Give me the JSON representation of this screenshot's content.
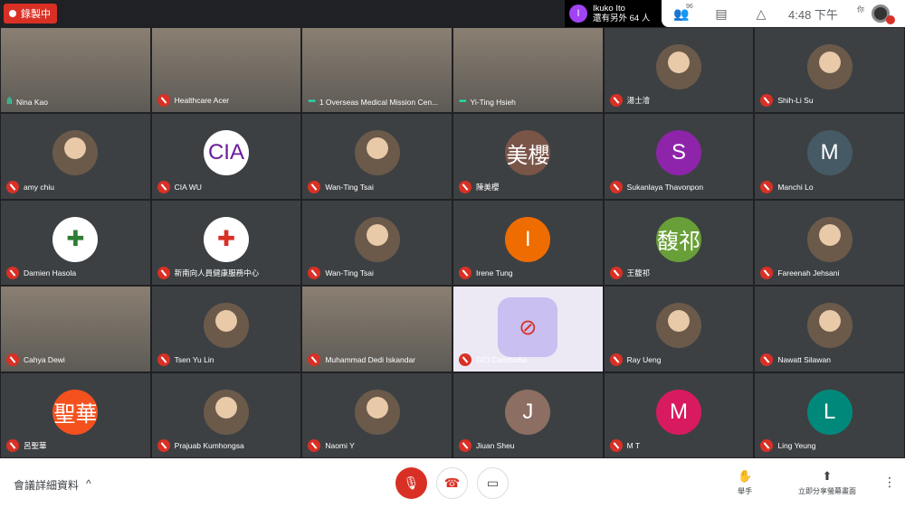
{
  "recording": {
    "label": "錄製中",
    "color": "#d93025"
  },
  "presenter": {
    "initial": "I",
    "name": "Ikuko Ito",
    "others": "還有另外 64 人"
  },
  "header": {
    "participant_count": "96",
    "time": "4:48 下午",
    "you_label": "你"
  },
  "tiles": [
    {
      "name": "Nina Kao",
      "type": "video",
      "status": "speaking"
    },
    {
      "name": "Healthcare Acer",
      "type": "video",
      "status": "muted"
    },
    {
      "name": "1 Overseas Medical Mission Cen...",
      "type": "video",
      "status": "speaking"
    },
    {
      "name": "Yi-Ting Hsieh",
      "type": "video",
      "status": "speaking"
    },
    {
      "name": "湯士澮",
      "type": "photo",
      "status": "muted"
    },
    {
      "name": "Shih-Li Su",
      "type": "photo",
      "status": "muted"
    },
    {
      "name": "amy chiu",
      "type": "photo",
      "status": "muted"
    },
    {
      "name": "CIA WU",
      "type": "letter",
      "avatar": "CIA",
      "color": "#ffffff",
      "text_color": "#6a1b9a",
      "status": "muted"
    },
    {
      "name": "Wan-Ting Tsai",
      "type": "photo",
      "status": "muted"
    },
    {
      "name": "陳美櫻",
      "type": "letter",
      "avatar": "美櫻",
      "color": "#795548",
      "status": "muted"
    },
    {
      "name": "Sukanlaya Thavonpon",
      "type": "letter",
      "avatar": "S",
      "color": "#8e24aa",
      "status": "muted"
    },
    {
      "name": "Manchi Lo",
      "type": "letter",
      "avatar": "M",
      "color": "#455a64",
      "status": "muted"
    },
    {
      "name": "Damien Hasola",
      "type": "letter",
      "avatar": "✚",
      "color": "#ffffff",
      "text_color": "#2e7d32",
      "status": "muted"
    },
    {
      "name": "新南向人員健康服務中心",
      "type": "letter",
      "avatar": "✚",
      "color": "#ffffff",
      "text_color": "#d93025",
      "status": "muted"
    },
    {
      "name": "Wan-Ting Tsai",
      "type": "photo",
      "status": "muted"
    },
    {
      "name": "Irene Tung",
      "type": "letter",
      "avatar": "I",
      "color": "#ef6c00",
      "status": "muted"
    },
    {
      "name": "王馥祁",
      "type": "letter",
      "avatar": "馥祁",
      "color": "#689f38",
      "status": "muted"
    },
    {
      "name": "Fareenah Jehsani",
      "type": "photo",
      "status": "muted"
    },
    {
      "name": "Cahya Dewi",
      "type": "video",
      "status": "muted"
    },
    {
      "name": "Tsen Yu Lin",
      "type": "photo",
      "status": "muted"
    },
    {
      "name": "Muhammad Dedi Iskandar",
      "type": "video",
      "status": "muted"
    },
    {
      "name": "GCI Cambodia",
      "type": "camera-off",
      "status": "muted"
    },
    {
      "name": "Ray Ueng",
      "type": "photo",
      "status": "muted"
    },
    {
      "name": "Nawatt Silawan",
      "type": "photo",
      "status": "muted"
    },
    {
      "name": "呂聖華",
      "type": "letter",
      "avatar": "聖華",
      "color": "#f4511e",
      "status": "muted"
    },
    {
      "name": "Prajuab Kumhongsa",
      "type": "photo",
      "status": "muted"
    },
    {
      "name": "Naomi Y",
      "type": "photo",
      "status": "muted"
    },
    {
      "name": "Jiuan Sheu",
      "type": "letter",
      "avatar": "J",
      "color": "#8d6e63",
      "status": "muted"
    },
    {
      "name": "M T",
      "type": "letter",
      "avatar": "M",
      "color": "#d81b60",
      "status": "muted"
    },
    {
      "name": "Ling Yeung",
      "type": "letter",
      "avatar": "L",
      "color": "#00897b",
      "status": "muted"
    }
  ],
  "bottom": {
    "details_label": "會議詳細資料",
    "raise_hand": "舉手",
    "present_now": "立即分享螢幕畫面"
  }
}
